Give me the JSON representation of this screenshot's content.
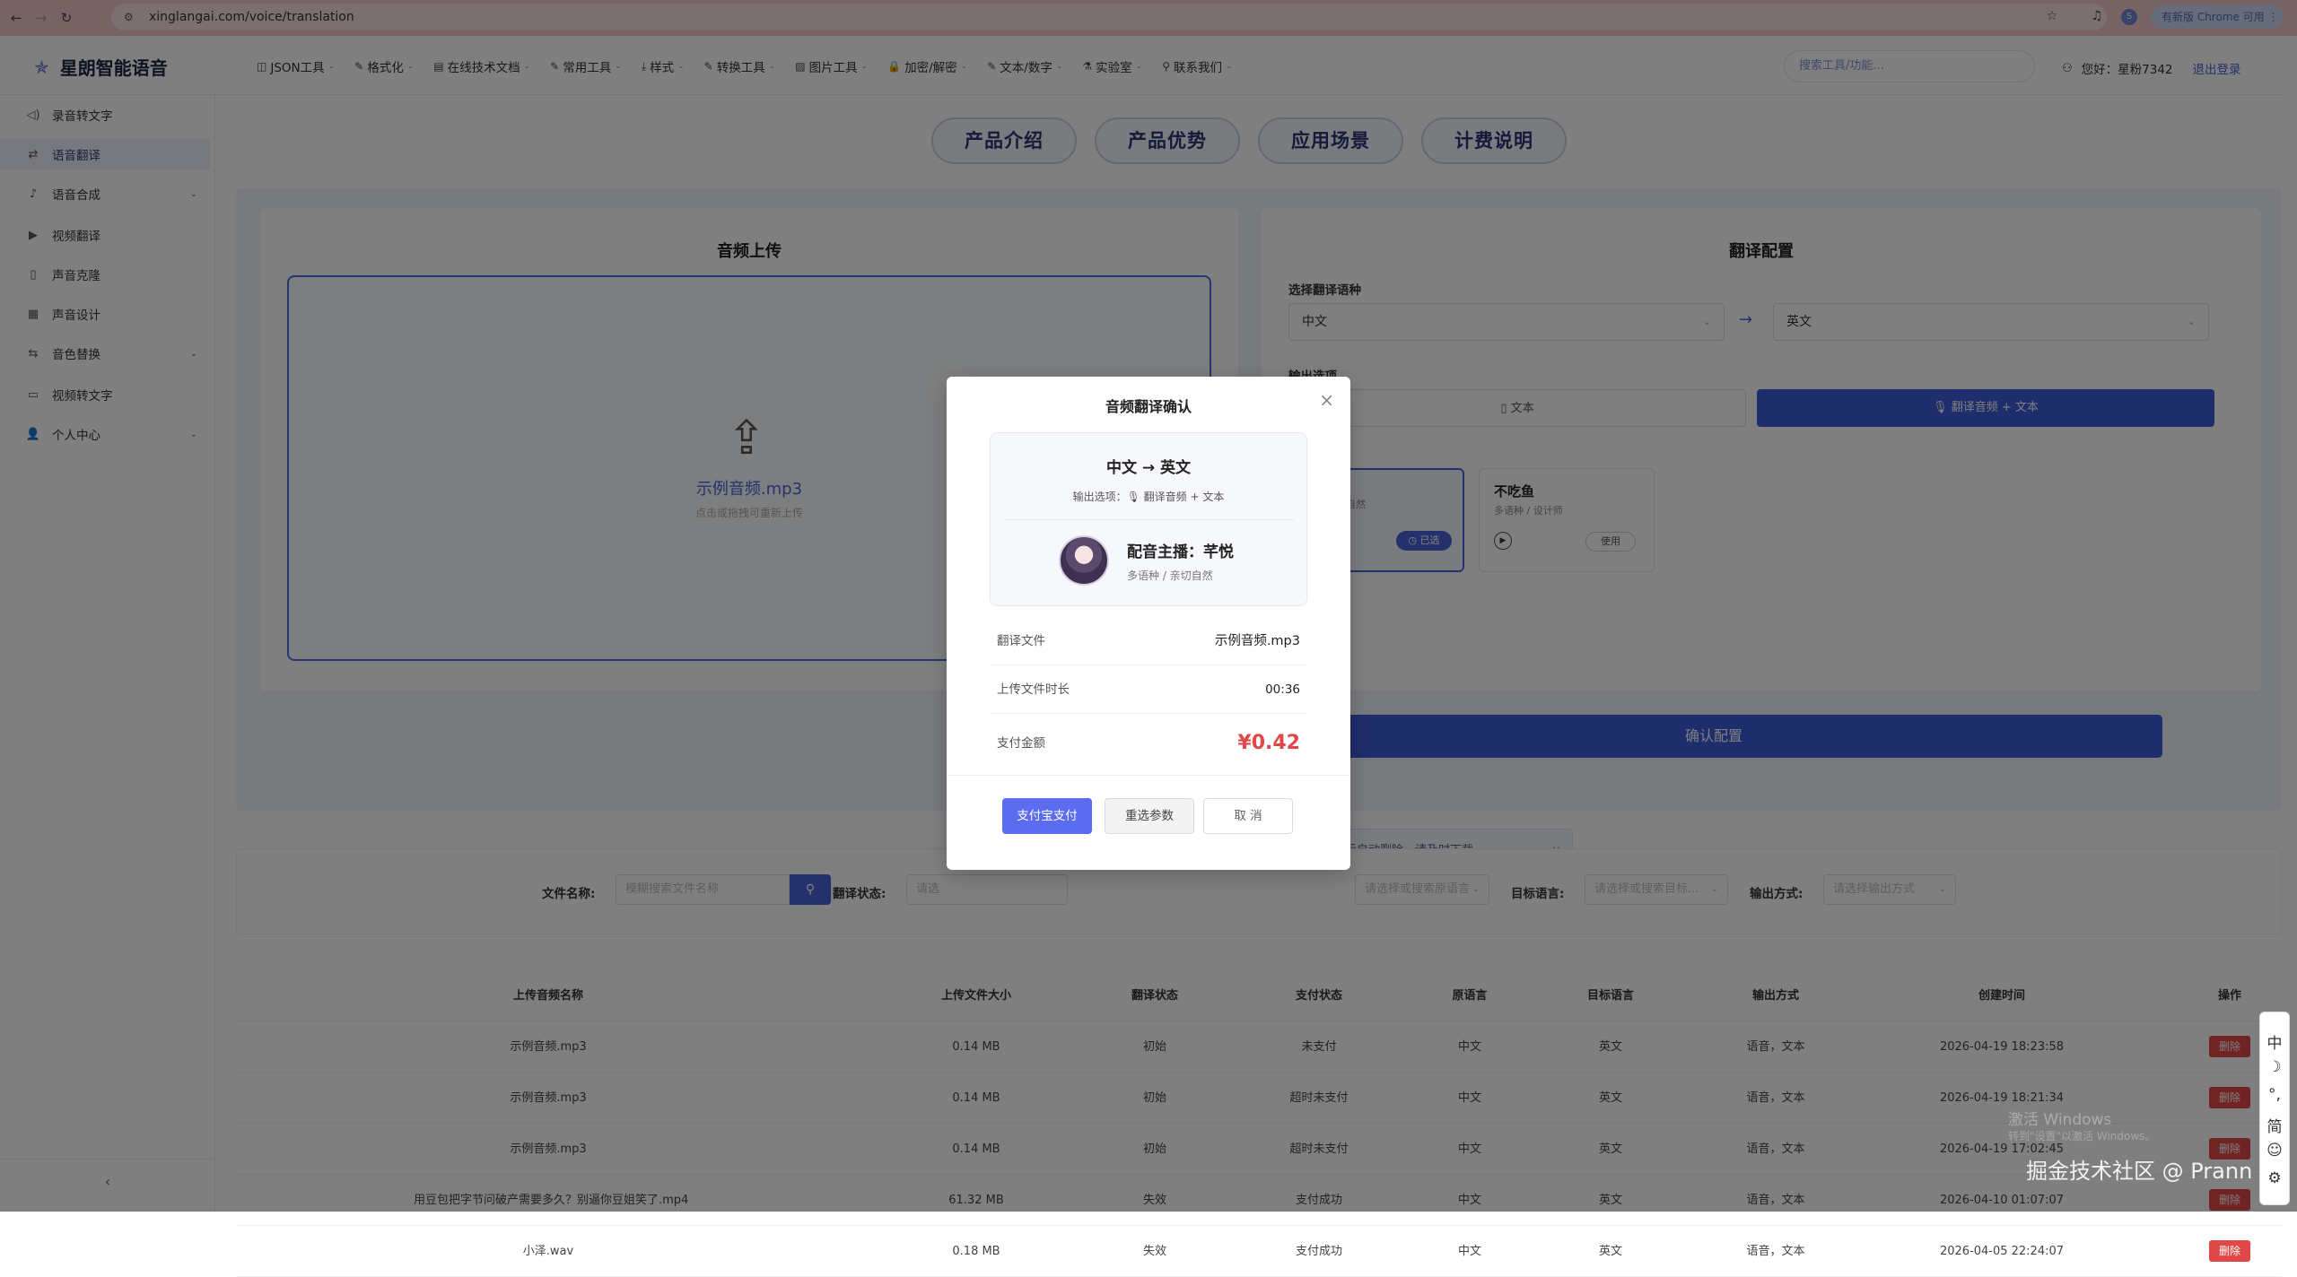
{
  "browser": {
    "url": "xinglangai.com/voice/translation",
    "badge": "有新版 Chrome 可用"
  },
  "header": {
    "logo": "星朗智能语音",
    "nav": [
      {
        "label": "JSON工具",
        "icon": "◫"
      },
      {
        "label": "格式化",
        "icon": "✎"
      },
      {
        "label": "在线技术文档",
        "icon": "▤"
      },
      {
        "label": "常用工具",
        "icon": "✎"
      },
      {
        "label": "样式",
        "icon": "⤓"
      },
      {
        "label": "转换工具",
        "icon": "✎"
      },
      {
        "label": "图片工具",
        "icon": "▨"
      },
      {
        "label": "加密/解密",
        "icon": "🔒"
      },
      {
        "label": "文本/数字",
        "icon": "✎"
      },
      {
        "label": "实验室",
        "icon": "⚗"
      },
      {
        "label": "联系我们",
        "icon": "⚲"
      }
    ],
    "search_placeholder": "搜索工具/功能...",
    "greeting": "您好：星粉7342",
    "logout": "退出登录"
  },
  "sidebar": {
    "items": [
      {
        "label": "录音转文字",
        "icon": "◁)"
      },
      {
        "label": "语音翻译",
        "icon": "⇄"
      },
      {
        "label": "语音合成",
        "icon": "♪"
      },
      {
        "label": "视频翻译",
        "icon": "▶"
      },
      {
        "label": "声音克隆",
        "icon": "▯"
      },
      {
        "label": "声音设计",
        "icon": "▦"
      },
      {
        "label": "音色替换",
        "icon": "⇆"
      },
      {
        "label": "视频转文字",
        "icon": "▭"
      },
      {
        "label": "个人中心",
        "icon": "👤"
      }
    ]
  },
  "tabs": [
    "产品介绍",
    "产品优势",
    "应用场景",
    "计费说明"
  ],
  "upload": {
    "title": "音频上传",
    "filename": "示例音频.mp3",
    "hint": "点击或拖拽可重新上传"
  },
  "config": {
    "title": "翻译配置",
    "lang_label": "选择翻译语种",
    "source_lang": "中文",
    "target_lang": "英文",
    "output_label": "输出选项",
    "opt_text": "文本",
    "opt_audio_text": "翻译音频 + 文本",
    "voice_selected_desc": "亲切自然",
    "voice_selected_btn": "已选",
    "voice2_name": "不吃鱼",
    "voice2_desc": "多语种 / 设计师",
    "voice2_btn": "使用",
    "confirm": "确认配置"
  },
  "notice": "日后自动删除，请及时下载。",
  "filters": {
    "file_label": "文件名称:",
    "file_placeholder": "模糊搜索文件名称",
    "status_label": "翻译状态:",
    "status_placeholder": "请选",
    "src_placeholder": "请选择或搜索原语言",
    "target_label": "目标语言:",
    "target_placeholder": "请选择或搜索目标...",
    "output_label": "输出方式:",
    "output_placeholder": "请选择输出方式"
  },
  "table": {
    "headers": [
      "上传音频名称",
      "上传文件大小",
      "翻译状态",
      "支付状态",
      "原语言",
      "目标语言",
      "输出方式",
      "创建时间",
      "操作"
    ],
    "rows": [
      [
        "示例音频.mp3",
        "0.14 MB",
        "初始",
        "未支付",
        "中文",
        "英文",
        "语音，文本",
        "2026-04-19 18:23:58",
        "删除"
      ],
      [
        "示例音频.mp3",
        "0.14 MB",
        "初始",
        "超时未支付",
        "中文",
        "英文",
        "语音，文本",
        "2026-04-19 18:21:34",
        "删除"
      ],
      [
        "示例音频.mp3",
        "0.14 MB",
        "初始",
        "超时未支付",
        "中文",
        "英文",
        "语音，文本",
        "2026-04-19 17:02:45",
        "删除"
      ],
      [
        "用豆包把字节问破产需要多久？别逼你豆姐笑了.mp4",
        "61.32 MB",
        "失效",
        "支付成功",
        "中文",
        "英文",
        "语音，文本",
        "2026-04-10 01:07:07",
        "删除"
      ],
      [
        "小泽.wav",
        "0.18 MB",
        "失效",
        "支付成功",
        "中文",
        "英文",
        "语音，文本",
        "2026-04-05 22:24:07",
        "删除"
      ]
    ]
  },
  "modal": {
    "title": "音频翻译确认",
    "direction": "中文 → 英文",
    "output_option": "输出选项：🎙 翻译音频 + 文本",
    "voice_name": "配音主播：芊悦",
    "voice_desc": "多语种 / 亲切自然",
    "file_label": "翻译文件",
    "file_value": "示例音频.mp3",
    "duration_label": "上传文件时长",
    "duration_value": "00:36",
    "amount_label": "支付金额",
    "amount_value": "¥0.42",
    "btn_pay": "支付宝支付",
    "btn_reset": "重选参数",
    "btn_cancel": "取 消"
  },
  "watermark": {
    "windows": "激活 Windows",
    "windows_sub": "转到\"设置\"以激活 Windows。",
    "site": "掘金技术社区 @ Prann"
  },
  "ime": [
    "中",
    "☽",
    "°,",
    "简",
    "☺",
    "⚙"
  ],
  "colors": {
    "primary": "#4a63d8",
    "danger": "#e04848"
  }
}
